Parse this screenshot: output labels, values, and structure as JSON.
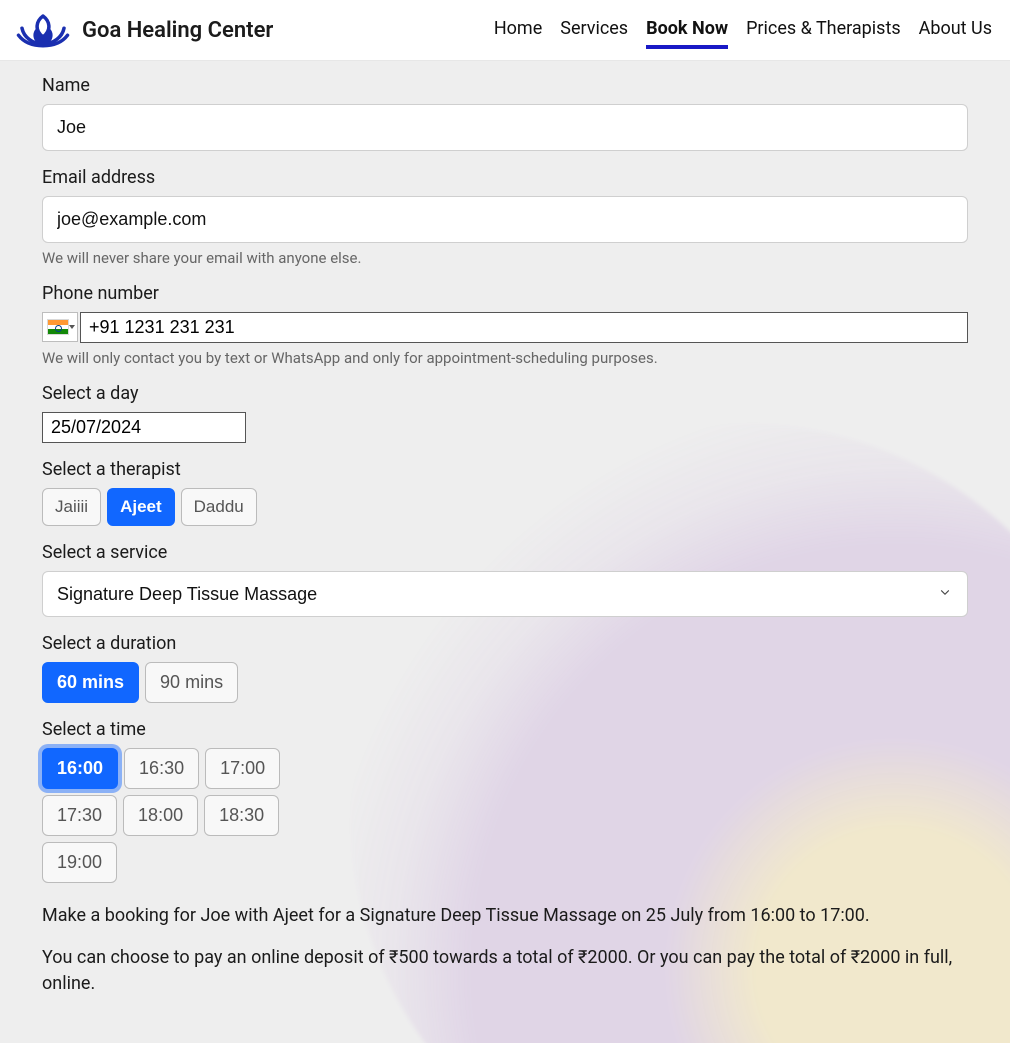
{
  "brand": {
    "title": "Goa Healing Center"
  },
  "nav": {
    "items": [
      {
        "label": "Home"
      },
      {
        "label": "Services"
      },
      {
        "label": "Book Now",
        "active": true
      },
      {
        "label": "Prices & Therapists"
      },
      {
        "label": "About Us"
      }
    ]
  },
  "form": {
    "name": {
      "label": "Name",
      "value": "Joe"
    },
    "email": {
      "label": "Email address",
      "value": "joe@example.com",
      "help": "We will never share your email with anyone else."
    },
    "phone": {
      "label": "Phone number",
      "value": "+91 1231 231 231",
      "help": "We will only contact you by text or WhatsApp and only for appointment-scheduling purposes.",
      "country": "India",
      "flag": "in"
    },
    "day": {
      "label": "Select a day",
      "value": "25/07/2024"
    },
    "therapist": {
      "label": "Select a therapist",
      "options": [
        "Jaiiii",
        "Ajeet",
        "Daddu"
      ],
      "selected": "Ajeet"
    },
    "service": {
      "label": "Select a service",
      "selected": "Signature Deep Tissue Massage"
    },
    "duration": {
      "label": "Select a duration",
      "options": [
        "60 mins",
        "90 mins"
      ],
      "selected": "60 mins"
    },
    "time": {
      "label": "Select a time",
      "options": [
        "16:00",
        "16:30",
        "17:00",
        "17:30",
        "18:00",
        "18:30",
        "19:00"
      ],
      "selected": "16:00"
    }
  },
  "summary": {
    "line1": "Make a booking for Joe with Ajeet for a Signature Deep Tissue Massage on 25 July from 16:00 to 17:00.",
    "line2": "You can choose to pay an online deposit of ₹500 towards a total of ₹2000. Or you can pay the total of ₹2000 in full, online."
  }
}
